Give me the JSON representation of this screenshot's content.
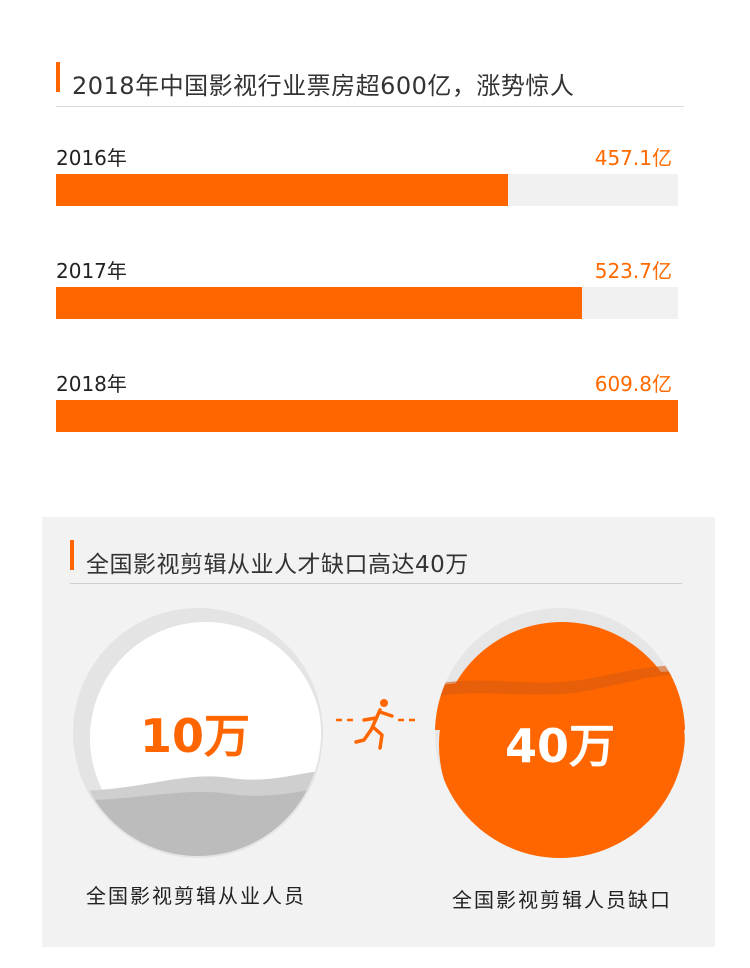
{
  "box_office": {
    "title": "2018年中国影视行业票房超600亿，涨势惊人"
  },
  "chart_data": {
    "type": "bar",
    "orientation": "horizontal",
    "title": "2018年中国影视行业票房超600亿，涨势惊人",
    "categories": [
      "2016年",
      "2017年",
      "2018年"
    ],
    "values": [
      457.1,
      523.7,
      609.8
    ],
    "value_labels": [
      "457.1亿",
      "523.7亿",
      "609.8亿"
    ],
    "xlim": [
      0,
      609.8
    ],
    "grid": false,
    "colors": {
      "fill": "#ff6600",
      "track": "#f1f1f1"
    }
  },
  "talent": {
    "title": "全国影视剪辑从业人才缺口高达40万",
    "left": {
      "number": "10万",
      "label": "全国影视剪辑从业人员",
      "fill_fraction": 0.25
    },
    "right": {
      "number": "40万",
      "label": "全国影视剪辑人员缺口",
      "fill_fraction": 0.8
    },
    "icon": "running-person-icon"
  },
  "colors": {
    "accent": "#ff6600",
    "panel": "#f2f2f2",
    "text": "#333333"
  }
}
